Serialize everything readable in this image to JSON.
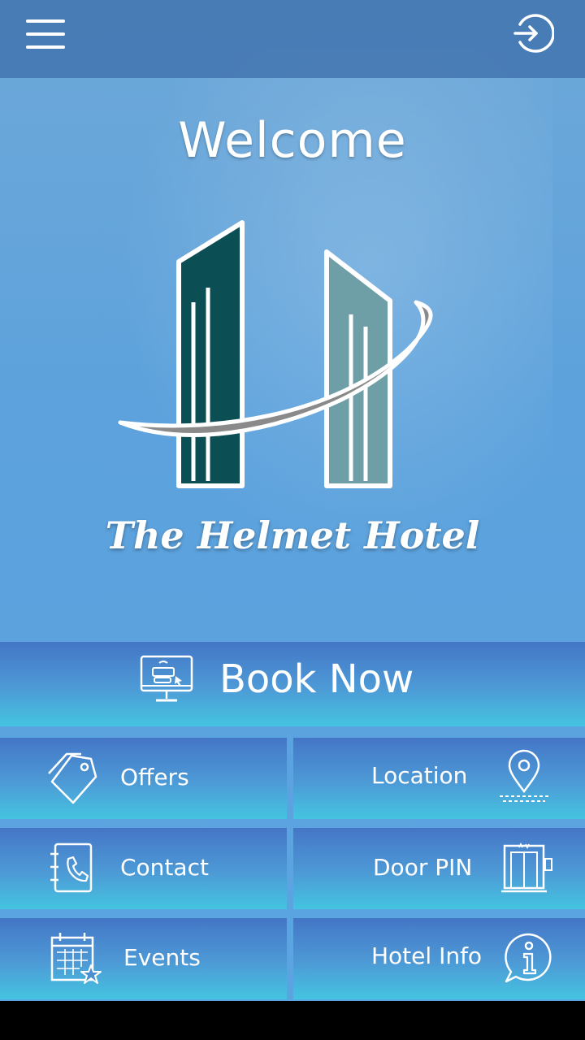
{
  "topbar": {
    "menu_icon": "hamburger-menu-icon",
    "login_icon": "sign-in-icon"
  },
  "hero": {
    "welcome": "Welcome",
    "hotel_name": "The Helmet Hotel",
    "logo_colors": {
      "left_tower": "#0b4f55",
      "right_tower": "#6e9ea6",
      "swoosh": "#8a8a8a"
    }
  },
  "book": {
    "label": "Book Now",
    "icon": "online-booking-monitor-icon"
  },
  "tiles": [
    {
      "label": "Offers",
      "icon": "price-tags-icon"
    },
    {
      "label": "Location",
      "icon": "map-pin-icon"
    },
    {
      "label": "Contact",
      "icon": "phone-book-icon"
    },
    {
      "label": "Door PIN",
      "icon": "elevator-keypad-icon"
    },
    {
      "label": "Events",
      "icon": "calendar-star-icon"
    },
    {
      "label": "Hotel Info",
      "icon": "info-bubble-icon"
    }
  ],
  "colors": {
    "tile_top": "#4476c6",
    "tile_bottom": "#44c4e0",
    "topbar": "#3c6eaa"
  }
}
